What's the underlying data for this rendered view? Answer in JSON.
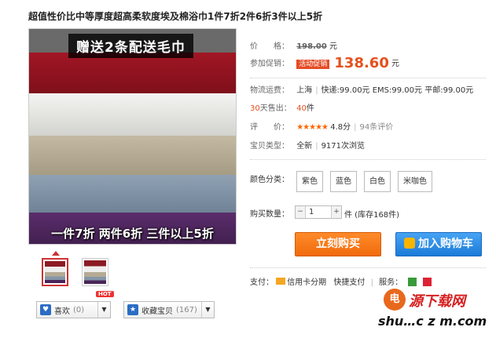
{
  "title": "超值性价比中等厚度超高柔软度埃及棉浴巾1件7折2件6折3件以上5折",
  "image": {
    "banner_top": "赠送2条配送毛巾",
    "banner_bottom": "一件7折 两件6折 三件以上5折"
  },
  "price": {
    "label": "价　　格：",
    "original": "198.00",
    "unit": "元"
  },
  "promo": {
    "label": "参加促销：",
    "badge": "活动促销",
    "price": "138.60",
    "unit": "元"
  },
  "shipping": {
    "label": "物流运费：",
    "origin": "上海",
    "detail": "快递:99.00元 EMS:99.00元 平邮:99.00元"
  },
  "sales": {
    "days": "30",
    "label": "天售出：",
    "count": "40",
    "unit": "件"
  },
  "rating": {
    "label": "评　　价：",
    "stars": "★★★★★",
    "score": "4.8分",
    "reviews": "94条评价"
  },
  "condition": {
    "label": "宝贝类型：",
    "value": "全新",
    "views": "9171次浏览"
  },
  "colors": {
    "label": "颜色分类：",
    "options": [
      "紫色",
      "蓝色",
      "白色",
      "米咖色"
    ]
  },
  "quantity": {
    "label": "购买数量：",
    "value": "1",
    "unit": "件 (库存168件)"
  },
  "actions": {
    "buy": "立刻购买",
    "cart": "加入购物车"
  },
  "payment": {
    "label": "支付：",
    "credit": "信用卡分期",
    "quick": "快捷支付",
    "service": "服务："
  },
  "social": {
    "like_label": "喜欢",
    "like_count": "(0)",
    "hot_badge": "HOT",
    "fav_label": "收藏宝贝",
    "fav_count": "(167)"
  },
  "watermark": {
    "logo": "电",
    "site": "源下载网",
    "url": "shu…c z m.com"
  },
  "accent": "#e5511d",
  "buy_color": "#f06a0a",
  "cart_color": "#1b7bd8"
}
